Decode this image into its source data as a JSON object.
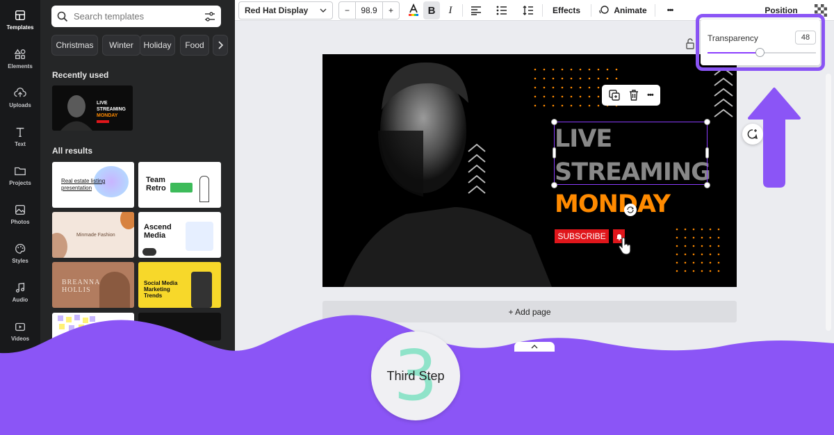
{
  "rail": [
    {
      "label": "Templates",
      "icon": "templates-icon"
    },
    {
      "label": "Elements",
      "icon": "elements-icon"
    },
    {
      "label": "Uploads",
      "icon": "upload-icon"
    },
    {
      "label": "Text",
      "icon": "text-icon"
    },
    {
      "label": "Projects",
      "icon": "folder-icon"
    },
    {
      "label": "Photos",
      "icon": "photo-icon"
    },
    {
      "label": "Styles",
      "icon": "palette-icon"
    },
    {
      "label": "Audio",
      "icon": "music-icon"
    },
    {
      "label": "Videos",
      "icon": "video-icon"
    }
  ],
  "search": {
    "placeholder": "Search templates"
  },
  "chips": [
    "Christmas",
    "Winter",
    "Holiday",
    "Food"
  ],
  "recently_used_label": "Recently used",
  "all_results_label": "All results",
  "recent_thumb": {
    "line1": "LIVE",
    "line2": "STREAMING",
    "line3": "MONDAY"
  },
  "templates": [
    {
      "title": "Real estate listing presentation"
    },
    {
      "title": "Team Retro"
    },
    {
      "title": "Minmade Fashion"
    },
    {
      "title": "Ascend Media"
    },
    {
      "title": "BREANNA HOLLIS"
    },
    {
      "title": "Social Media Marketing Trends"
    }
  ],
  "toolbar": {
    "font": "Red Hat Display",
    "font_size": "98.9",
    "minus": "−",
    "plus": "+",
    "bold": "B",
    "italic": "I",
    "effects": "Effects",
    "animate": "Animate",
    "more": "•••",
    "position": "Position"
  },
  "transparency": {
    "label": "Transparency",
    "value": "48",
    "level": 0.48
  },
  "design": {
    "line1": "LIVE",
    "line2": "STREAMING",
    "line3": "MONDAY",
    "subscribe": "SUBSCRIBE"
  },
  "add_page": "+ Add page",
  "step": {
    "number": "3",
    "label": "Third Step"
  },
  "colors": {
    "accent": "#8b55f6",
    "orange": "#ff8a00",
    "subscribe": "#e0161b",
    "teal": "#8fe3c9"
  }
}
